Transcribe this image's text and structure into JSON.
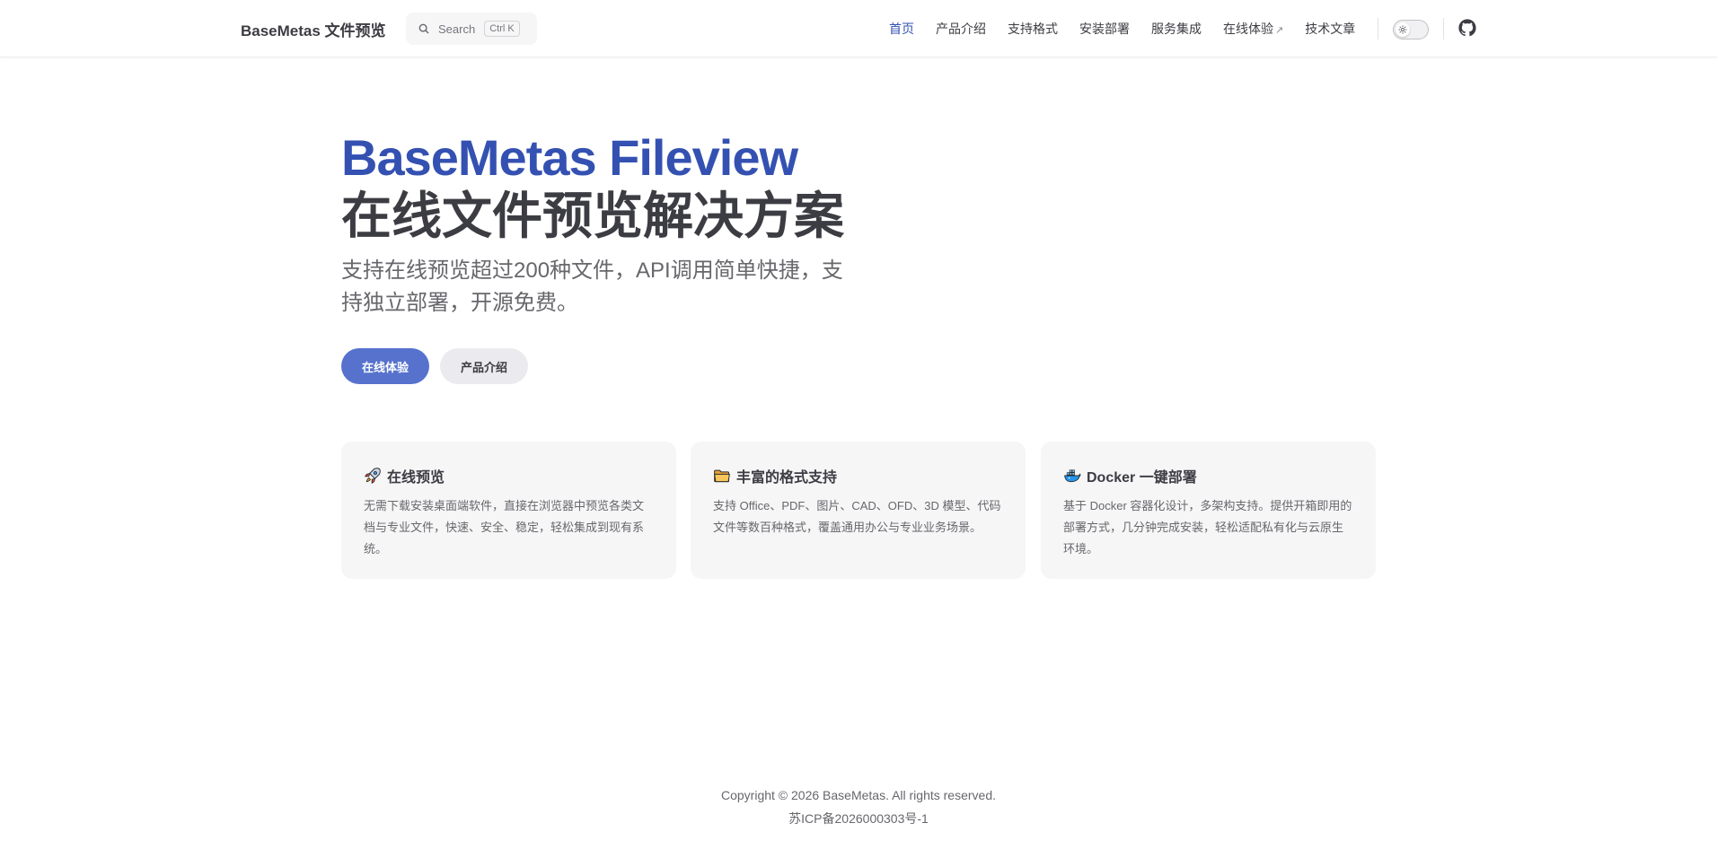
{
  "nav": {
    "brand": "BaseMetas 文件预览",
    "search_label": "Search",
    "search_shortcut": "Ctrl K",
    "links": [
      {
        "label": "首页",
        "active": true,
        "external": false
      },
      {
        "label": "产品介绍",
        "active": false,
        "external": false
      },
      {
        "label": "支持格式",
        "active": false,
        "external": false
      },
      {
        "label": "安装部署",
        "active": false,
        "external": false
      },
      {
        "label": "服务集成",
        "active": false,
        "external": false
      },
      {
        "label": "在线体验",
        "active": false,
        "external": true
      },
      {
        "label": "技术文章",
        "active": false,
        "external": false
      }
    ],
    "external_arrow": "↗",
    "icons": {
      "search": "search-icon",
      "theme": "sun-icon",
      "github": "github-icon"
    }
  },
  "hero": {
    "name": "BaseMetas Fileview",
    "text": "在线文件预览解决方案",
    "tagline": "支持在线预览超过200种文件，API调用简单快捷，支持独立部署，开源免费。",
    "primary_button": "在线体验",
    "secondary_button": "产品介绍"
  },
  "features": [
    {
      "icon": "rocket-icon",
      "title": "在线预览",
      "desc": "无需下载安装桌面端软件，直接在浏览器中预览各类文档与专业文件，快速、安全、稳定，轻松集成到现有系统。"
    },
    {
      "icon": "folder-icon",
      "title": "丰富的格式支持",
      "desc": "支持 Office、PDF、图片、CAD、OFD、3D 模型、代码文件等数百种格式，覆盖通用办公与专业业务场景。"
    },
    {
      "icon": "docker-icon",
      "title": "Docker 一键部署",
      "desc": "基于 Docker 容器化设计，多架构支持。提供开箱即用的部署方式，几分钟完成安装，轻松适配私有化与云原生环境。"
    }
  ],
  "footer": {
    "copyright": "Copyright © 2026 BaseMetas. All rights reserved.",
    "icp": "苏ICP备2026000303号-1"
  },
  "colors": {
    "brand": "#3451b2",
    "button_brand": "#5672cd",
    "text": "#3c3c43",
    "muted": "#67676c",
    "card_bg": "#f6f6f7"
  }
}
